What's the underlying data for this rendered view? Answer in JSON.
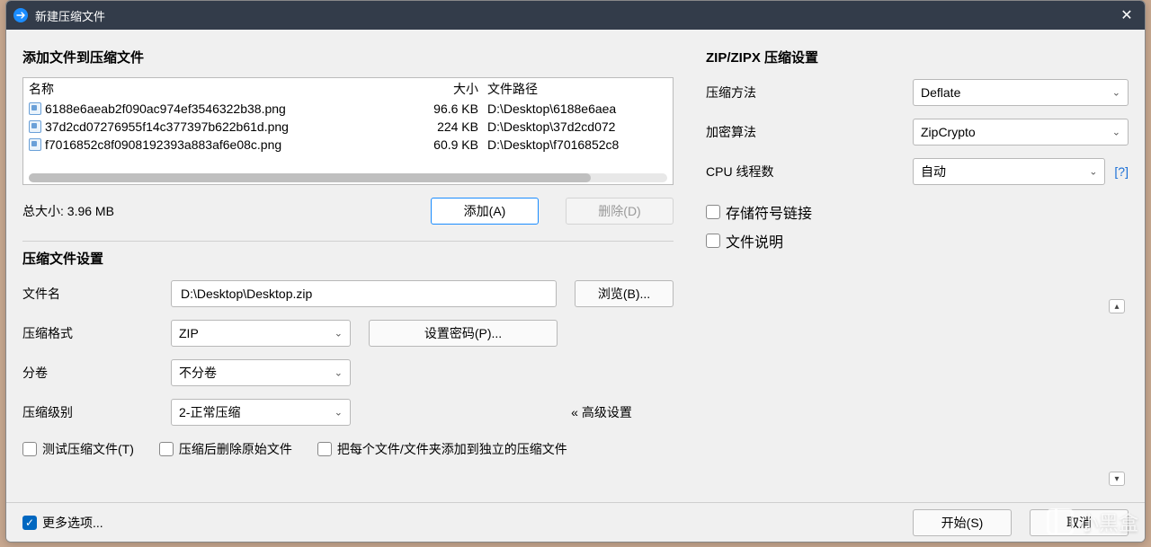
{
  "window": {
    "title": "新建压缩文件",
    "close_glyph": "✕"
  },
  "left": {
    "add_heading": "添加文件到压缩文件",
    "columns": {
      "name": "名称",
      "size": "大小",
      "path": "文件路径"
    },
    "files": [
      {
        "name": "6188e6aeab2f090ac974ef3546322b38.png",
        "size": "96.6 KB",
        "path": "D:\\Desktop\\6188e6aea"
      },
      {
        "name": "37d2cd07276955f14c377397b622b61d.png",
        "size": "224 KB",
        "path": "D:\\Desktop\\37d2cd072"
      },
      {
        "name": "f7016852c8f0908192393a883af6e08c.png",
        "size": "60.9 KB",
        "path": "D:\\Desktop\\f7016852c8"
      }
    ],
    "total_label": "总大小: 3.96 MB",
    "add_btn": "添加(A)",
    "delete_btn": "删除(D)",
    "settings_heading": "压缩文件设置",
    "filename_label": "文件名",
    "filename_value": "D:\\Desktop\\Desktop.zip",
    "browse_btn": "浏览(B)...",
    "format_label": "压缩格式",
    "format_value": "ZIP",
    "set_password_btn": "设置密码(P)...",
    "split_label": "分卷",
    "split_value": "不分卷",
    "level_label": "压缩级别",
    "level_value": "2-正常压缩",
    "adv_settings_btn": "« 高级设置",
    "chk_test": "测试压缩文件(T)",
    "chk_delete_after": "压缩后删除原始文件",
    "chk_each_separate": "把每个文件/文件夹添加到独立的压缩文件"
  },
  "right": {
    "heading": "ZIP/ZIPX 压缩设置",
    "method_label": "压缩方法",
    "method_value": "Deflate",
    "encrypt_label": "加密算法",
    "encrypt_value": "ZipCrypto",
    "cpu_label": "CPU 线程数",
    "cpu_value": "自动",
    "help": "[?]",
    "chk_symlink": "存储符号链接",
    "chk_comment": "文件说明"
  },
  "footer": {
    "more_options": "更多选项...",
    "start_btn": "开始(S)",
    "cancel_btn": "取消"
  },
  "watermark": "小黑盒"
}
